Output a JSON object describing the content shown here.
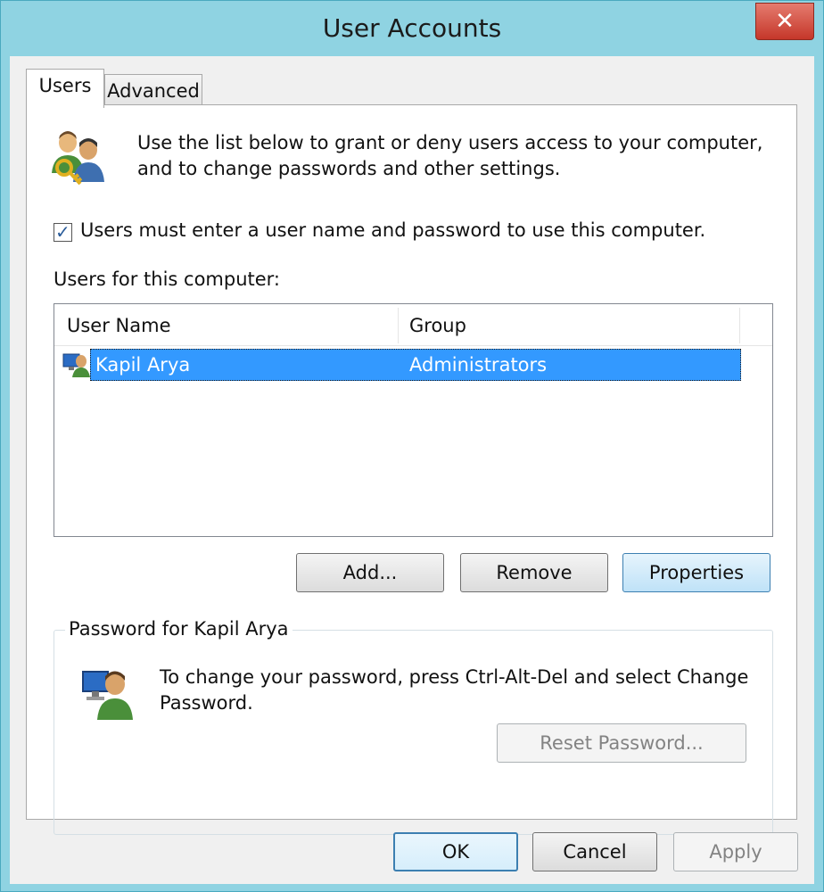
{
  "window": {
    "title": "User Accounts"
  },
  "tabs": [
    {
      "label": "Users"
    },
    {
      "label": "Advanced"
    }
  ],
  "intro": {
    "line1": "Use the list below to grant or deny users access to your computer,",
    "line2": "and to change passwords and other settings."
  },
  "require_login": {
    "label": "Users must enter a user name and password to use this computer.",
    "checked": true
  },
  "users_list": {
    "label": "Users for this computer:",
    "columns": [
      "User Name",
      "Group"
    ],
    "rows": [
      {
        "user_name": "Kapil Arya",
        "group": "Administrators"
      }
    ]
  },
  "list_buttons": {
    "add": "Add...",
    "remove": "Remove",
    "properties": "Properties"
  },
  "password_group": {
    "title": "Password for Kapil Arya",
    "line1": "To change your password, press Ctrl-Alt-Del and select Change",
    "line2": "Password.",
    "reset_button": "Reset Password..."
  },
  "dialog_buttons": {
    "ok": "OK",
    "cancel": "Cancel",
    "apply": "Apply"
  },
  "colors": {
    "titlebar": "#8fd3e2",
    "selection": "#3399ff",
    "close_button": "#c5372a"
  }
}
